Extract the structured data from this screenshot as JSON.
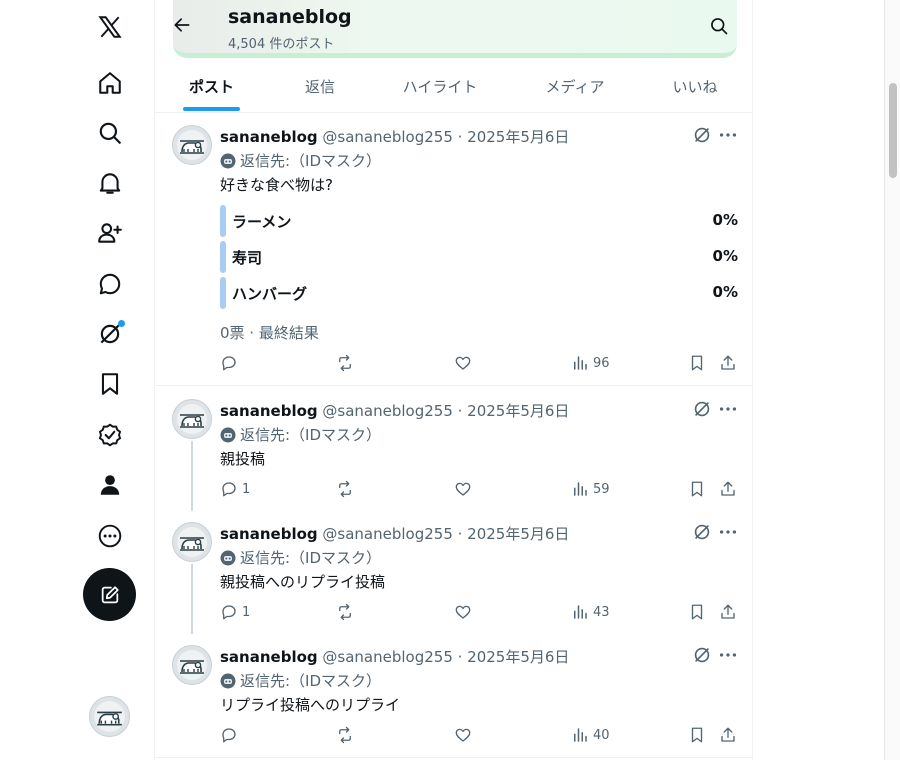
{
  "header": {
    "title": "sananeblog",
    "post_count": "4,504 件のポスト"
  },
  "tabs": [
    {
      "label": "ポスト",
      "active": true
    },
    {
      "label": "返信",
      "active": false
    },
    {
      "label": "ハイライト",
      "active": false
    },
    {
      "label": "メディア",
      "active": false
    },
    {
      "label": "いいね",
      "active": false
    }
  ],
  "nav_icons": [
    "x-logo-icon",
    "home-icon",
    "search-icon",
    "notifications-icon",
    "follow-icon",
    "messages-icon",
    "grok-icon",
    "bookmarks-icon",
    "verified-icon",
    "profile-icon",
    "more-icon"
  ],
  "colors": {
    "accent": "#1d9bf0",
    "text": "#0f1419",
    "muted": "#536471",
    "poll_bar": "#a9cdf2"
  },
  "posts": [
    {
      "name": "sananeblog",
      "meta": "@sananeblog255 · 2025年5月6日",
      "reply_label": "返信先:（IDマスク）",
      "text": "好きな食べ物は?",
      "poll": {
        "options": [
          {
            "label": "ラーメン",
            "pct": "0%"
          },
          {
            "label": "寿司",
            "pct": "0%"
          },
          {
            "label": "ハンバーグ",
            "pct": "0%"
          }
        ],
        "meta": "0票 · 最終結果"
      },
      "replies": "",
      "views": "96"
    },
    {
      "name": "sananeblog",
      "meta": "@sananeblog255 · 2025年5月6日",
      "reply_label": "返信先:（IDマスク）",
      "text": "親投稿",
      "replies": "1",
      "views": "59"
    },
    {
      "name": "sananeblog",
      "meta": "@sananeblog255 · 2025年5月6日",
      "reply_label": "返信先:（IDマスク）",
      "text": "親投稿へのリプライ投稿",
      "replies": "1",
      "views": "43"
    },
    {
      "name": "sananeblog",
      "meta": "@sananeblog255 · 2025年5月6日",
      "reply_label": "返信先:（IDマスク）",
      "text": "リプライ投稿へのリプライ",
      "replies": "",
      "views": "40"
    }
  ]
}
